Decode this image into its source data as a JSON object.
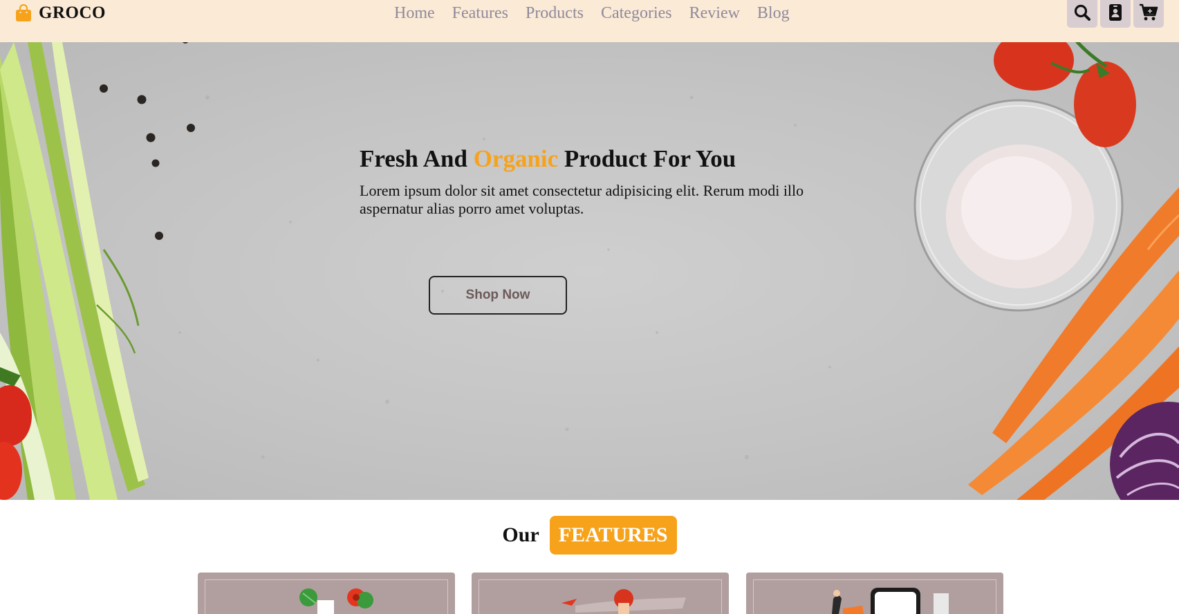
{
  "brand": {
    "name": "GROCO",
    "icon": "shopping-bag-icon"
  },
  "nav": [
    {
      "label": "Home"
    },
    {
      "label": "Features"
    },
    {
      "label": "Products"
    },
    {
      "label": "Categories"
    },
    {
      "label": "Review"
    },
    {
      "label": "Blog"
    }
  ],
  "header_icons": [
    "search-icon",
    "contact-card-icon",
    "cart-icon"
  ],
  "hero": {
    "title_before": "Fresh And ",
    "title_accent": "Organic",
    "title_after": " Product For You",
    "text": "Lorem ipsum dolor sit amet consectetur adipisicing elit. Rerum modi illo aspernatur alias porro amet voluptas.",
    "button": "Shop Now"
  },
  "features": {
    "heading_prefix": "Our",
    "heading_badge": "FEATURES",
    "cards": [
      {
        "illustration": "fresh-vegetables-illustration"
      },
      {
        "illustration": "delivery-person-illustration"
      },
      {
        "illustration": "mobile-payment-illustration"
      }
    ]
  },
  "colors": {
    "header_bg": "#fbead5",
    "accent": "#f7a21b",
    "nav_text": "#8e8a9c",
    "icon_button_bg": "#d8cdd0",
    "card_bg": "#b19e9f"
  }
}
